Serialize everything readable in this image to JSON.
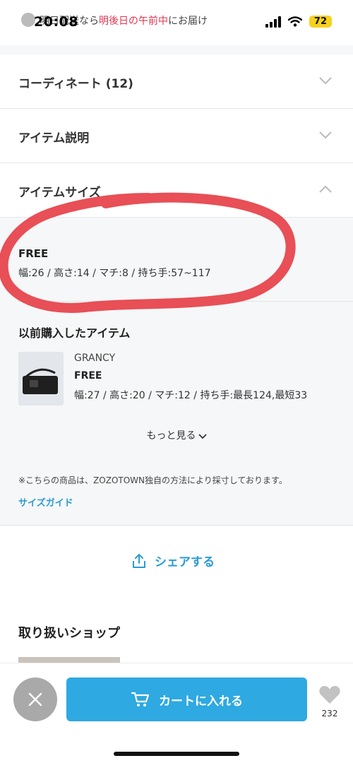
{
  "status_bar": {
    "time": "20:08",
    "battery": "72",
    "notice_prefix": "明日配送なら",
    "notice_highlight": "明後日の午前中",
    "notice_suffix": "にお届け"
  },
  "accordions": [
    {
      "title": "コーディネート (12)",
      "expanded": false
    },
    {
      "title": "アイテム説明",
      "expanded": false
    },
    {
      "title": "アイテムサイズ",
      "expanded": true
    }
  ],
  "item_size": {
    "size_name": "FREE",
    "dimensions": "幅:26 / 高さ:14 / マチ:8 / 持ち手:57~117"
  },
  "previous_purchase": {
    "title": "以前購入したアイテム",
    "brand": "GRANCY",
    "size_name": "FREE",
    "dimensions": "幅:27 / 高さ:20 / マチ:12 / 持ち手:最長124,最短33"
  },
  "more_label": "もっと見る",
  "note": "※こちらの商品は、ZOZOTOWN独自の方法により採寸しております。",
  "size_guide_label": "サイズガイド",
  "share_label": "シェアする",
  "shop_section_title": "取り扱いショップ",
  "bottom_bar": {
    "cart_label": "カートに入れる",
    "favorite_count": "232"
  },
  "colors": {
    "accent_blue": "#2ea9e1",
    "link_blue": "#2a9bd3",
    "annotation_red": "#e64048",
    "notice_red": "#e0354f"
  }
}
